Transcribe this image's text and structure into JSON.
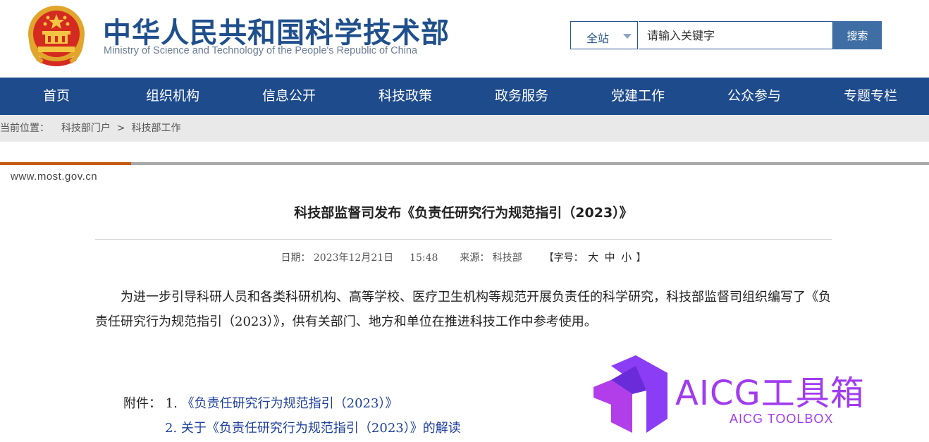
{
  "header": {
    "title": "中华人民共和国科学技术部",
    "subtitle": "Ministry of Science and Technology of the People's Republic of China",
    "search_scope": "全站",
    "search_placeholder": "请输入关键字",
    "search_button": "搜索"
  },
  "nav": {
    "items": [
      {
        "label": "首页"
      },
      {
        "label": "组织机构"
      },
      {
        "label": "信息公开"
      },
      {
        "label": "科技政策"
      },
      {
        "label": "政务服务"
      },
      {
        "label": "党建工作"
      },
      {
        "label": "公众参与"
      },
      {
        "label": "专题专栏"
      }
    ]
  },
  "breadcrumb": {
    "prefix": "当前位置：",
    "items": [
      "科技部门户",
      "科技部工作"
    ],
    "separator": " > "
  },
  "site_url": "www.most.gov.cn",
  "article": {
    "title": "科技部监督司发布《负责任研究行为规范指引（2023）》",
    "date_label": "日期：",
    "date": "2023年12月21日",
    "time": "15:48",
    "source_label": "来源：",
    "source": "科技部",
    "font_size_prefix": "【字号：",
    "font_size_options": [
      "大",
      "中",
      "小"
    ],
    "font_size_suffix": "】",
    "body": "为进一步引导科研人员和各类科研机构、高等学校、医疗卫生机构等规范开展负责任的科学研究，科技部监督司组织编写了《负责任研究行为规范指引（2023）》，供有关部门、地方和单位在推进科技工作中参考使用。",
    "attachments_label": "附件：",
    "attachments": [
      {
        "index": "1.",
        "title": "《负责任研究行为规范指引（2023）》"
      },
      {
        "index": "2.",
        "title": "关于《负责任研究行为规范指引（2023）》的解读"
      }
    ]
  },
  "watermark": {
    "title": "AICG工具箱",
    "subtitle": "AICG TOOLBOX"
  },
  "colors": {
    "nav_bg": "#1e4b8c",
    "title_blue": "#1f4f8c",
    "accent_orange": "#c55a11",
    "link_blue": "#1e3f9c",
    "watermark_purple": "#a13bf0"
  }
}
